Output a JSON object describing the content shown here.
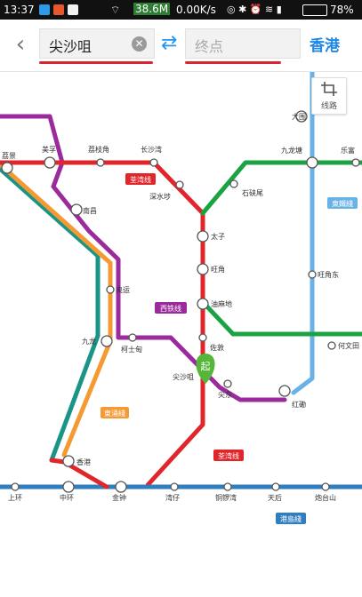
{
  "status_bar": {
    "time": "13:37",
    "speed": "38.6M",
    "rate": "0.00K/s",
    "battery": "78%"
  },
  "header": {
    "from": "尖沙咀",
    "to_placeholder": "终点",
    "city": "香港"
  },
  "route_button": {
    "label": "线路"
  },
  "map": {
    "stations": {
      "lai_king": "荔景",
      "mei_foo": "美孚",
      "lai_chi_kok": "荔枝角",
      "cheung_sha_wan": "长沙湾",
      "sham_shui_po": "深水埗",
      "shek_kip_mei": "石硖尾",
      "tai_wo_hau": "大围",
      "kowloon_tong": "九龙塘",
      "lok_fu": "乐富",
      "nam_cheong": "南昌",
      "prince_edward": "太子",
      "mong_kok": "旺角",
      "mong_kok_east": "旺角东",
      "yau_ma_tei": "油麻地",
      "olympic": "奥运",
      "kowloon": "九龙",
      "austin": "柯士甸",
      "jordan": "佐敦",
      "tsim_sha_tsui": "尖沙咀",
      "east_tst": "尖东",
      "hung_hom": "红磡",
      "ho_man_tin": "何文田",
      "hong_kong": "香港",
      "central": "中环",
      "admiralty": "金钟",
      "sheung_wan": "上环",
      "wan_chai": "湾仔",
      "causeway_bay": "铜锣湾",
      "tin_hau": "天后",
      "fortress_hill": "炮台山"
    },
    "lines": {
      "tsuen_wan": "荃湾线",
      "tsuen_wan_2": "荃湾线",
      "west_rail": "西铁线",
      "east_rail": "東鐵綫",
      "tung_chung": "東涌綫",
      "island": "港島綫"
    },
    "start_marker": "起"
  }
}
